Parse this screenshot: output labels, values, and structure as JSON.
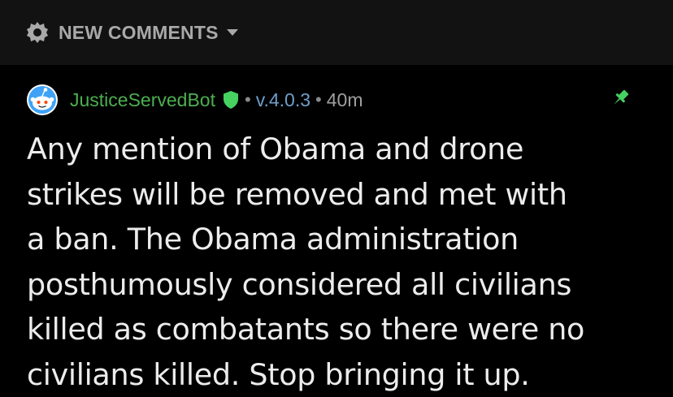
{
  "header": {
    "sort_label": "NEW COMMENTS",
    "sort_icon": "gear-badge-icon",
    "dropdown_icon": "chevron-down-icon"
  },
  "comment": {
    "avatar_icon": "snoo-bot-avatar-icon",
    "username": "JusticeServedBot",
    "mod_badge_icon": "shield-icon",
    "separator": "•",
    "flair": "v.4.0.3",
    "age": "40m",
    "pinned_icon": "pin-icon",
    "body_lines": [
      "Any mention of Obama and drone",
      "strikes will be removed and met with",
      "a ban. The Obama administration",
      "posthumously considered all civilians",
      "killed as combatants so there were no",
      "civilians killed. Stop bringing it up."
    ]
  },
  "colors": {
    "background": "#000000",
    "topbar": "#121212",
    "username_green": "#4caf50",
    "mod_shield_green": "#46d160",
    "flair_blue": "#6f9ec9",
    "meta_gray": "#9e9e9e",
    "body_text": "#ececec"
  }
}
